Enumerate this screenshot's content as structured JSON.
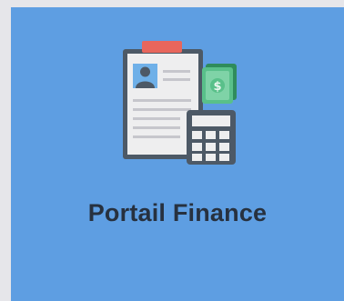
{
  "tile": {
    "label": "Portail Finance",
    "icon": "finance-document-calculator-icon",
    "background_color": "#5e9ee2",
    "label_color": "#27313f"
  }
}
